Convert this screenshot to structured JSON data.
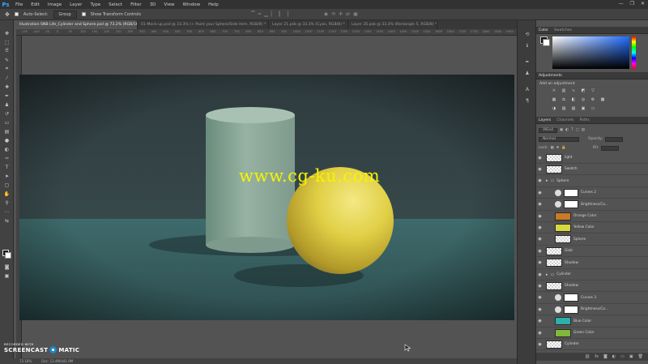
{
  "app": {
    "logo": "Ps"
  },
  "menu": [
    "File",
    "Edit",
    "Image",
    "Layer",
    "Type",
    "Select",
    "Filter",
    "3D",
    "View",
    "Window",
    "Help"
  ],
  "window_controls": [
    "—",
    "❐",
    "✕"
  ],
  "options_bar": {
    "auto_select_label": "Auto-Select:",
    "auto_select_value": "Group",
    "show_transform_label": "Show Transform Controls"
  },
  "tabs": [
    "Illustration SNB Life_Cylinder and Sphere.psd @ 73.2% (RGB/16) *",
    "01-Mock-up.psd @ 33.3% (+ Paint your Sphere/Side item, RGB/8) *",
    "Layer 21.psb @ 33.3% (Cyan, RGB/8) *",
    "Layer 35.psb @ 33.3% (Rectangle 5, RGB/8) *"
  ],
  "ruler_ticks": [
    "-150",
    "-100",
    "-50",
    "0",
    "50",
    "100",
    "150",
    "200",
    "250",
    "300",
    "350",
    "400",
    "450",
    "500",
    "550",
    "600",
    "650",
    "700",
    "750",
    "800",
    "850",
    "900",
    "950",
    "1000",
    "1050",
    "1100",
    "1150",
    "1200",
    "1250",
    "1300",
    "1350",
    "1400",
    "1450",
    "1500",
    "1550",
    "1600",
    "1650",
    "1700",
    "1750",
    "1800",
    "1850",
    "1900"
  ],
  "watermark": "www.cg-ku.com",
  "status": {
    "zoom": "73.18%",
    "doc": "Doc: 13.4M/441.9M"
  },
  "screencast": {
    "recorded": "RECORDED WITH",
    "brand_left": "SCREENCAST",
    "brand_right": "MATIC"
  },
  "panels": {
    "color_tabs": [
      "Color",
      "Swatches"
    ],
    "adjustments_title": "Adjustments",
    "adjustments_label": "Add an adjustment",
    "layers_tabs": [
      "Layers",
      "Channels",
      "Paths"
    ],
    "kind_label": "Kind",
    "blend_mode": "Normal",
    "opacity_label": "Opacity:",
    "lock_label": "Lock:",
    "fill_label": "Fill:"
  },
  "layers": [
    {
      "name": "light",
      "kind": "checker"
    },
    {
      "name": "Swatch",
      "kind": "checker"
    },
    {
      "name": "Sphere",
      "kind": "group"
    },
    {
      "name": "Curves 2",
      "kind": "adjustment"
    },
    {
      "name": "Brightness/Co...",
      "kind": "adjustment"
    },
    {
      "name": "Orange Color",
      "kind": "fill",
      "color": "#c97a26"
    },
    {
      "name": "Yellow Color",
      "kind": "fill",
      "color": "#d7d83e"
    },
    {
      "name": "Sphere",
      "kind": "sphere"
    },
    {
      "name": "Glob",
      "kind": "checker"
    },
    {
      "name": "Shadow",
      "kind": "checker"
    },
    {
      "name": "Cylinder",
      "kind": "group"
    },
    {
      "name": "Shadow",
      "kind": "checker"
    },
    {
      "name": "Curves 3",
      "kind": "adjustment"
    },
    {
      "name": "Brightness/Co...",
      "kind": "adjustment"
    },
    {
      "name": "Blue Color",
      "kind": "fill",
      "color": "#2eafa7"
    },
    {
      "name": "Green Color",
      "kind": "fill",
      "color": "#7fb83a"
    },
    {
      "name": "Cylinder",
      "kind": "checker"
    }
  ],
  "colors": {
    "accent": "#31a8ff",
    "watermark": "#f6f300"
  }
}
